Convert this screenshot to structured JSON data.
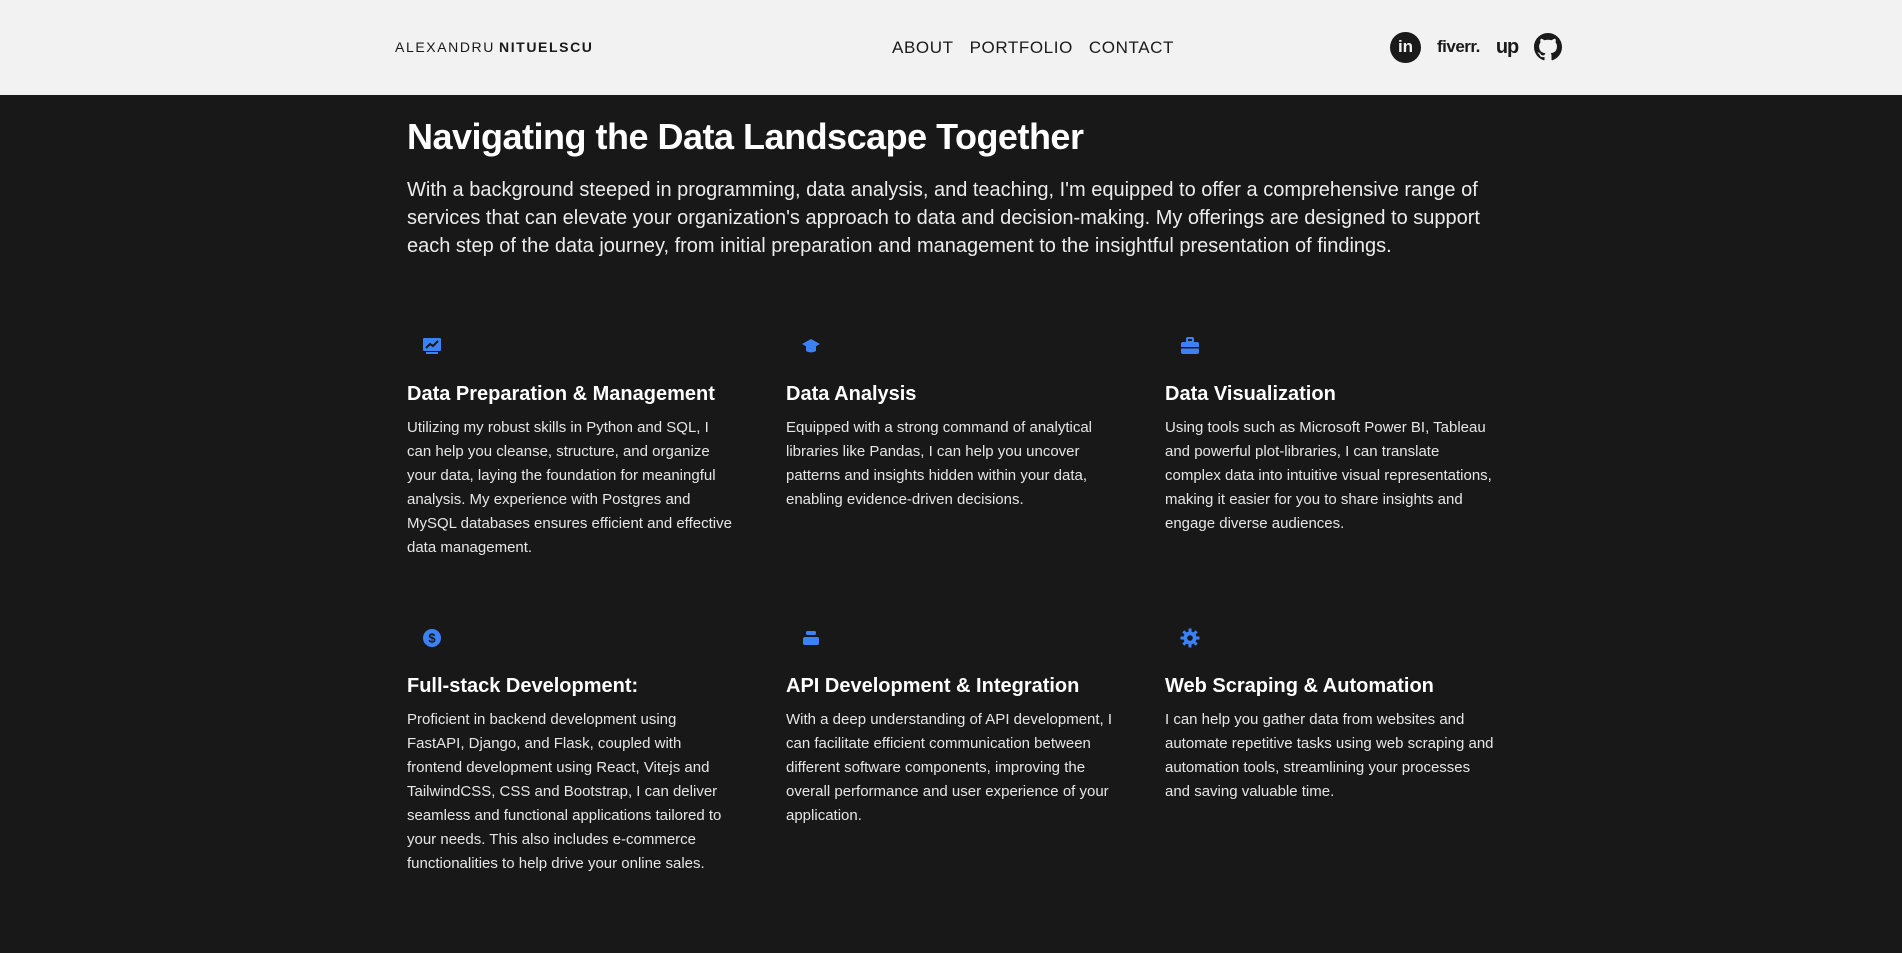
{
  "header": {
    "brand_first": "ALEXANDRU",
    "brand_last": "NITUELSCU",
    "nav": [
      {
        "label": "ABOUT"
      },
      {
        "label": "PORTFOLIO"
      },
      {
        "label": "CONTACT"
      }
    ],
    "socials": {
      "linkedin": "in",
      "fiverr": "fiverr.",
      "upwork": "up"
    }
  },
  "hero": {
    "title": "Navigating the Data Landscape Together",
    "description": "With a background steeped in programming, data analysis, and teaching, I'm equipped to offer a comprehensive range of services that can elevate your organization's approach to data and decision-making. My offerings are designed to support each step of the data journey, from initial preparation and management to the insightful presentation of findings."
  },
  "services": [
    {
      "icon": "chart-icon",
      "title": "Data Preparation & Management",
      "text": "Utilizing my robust skills in Python and SQL, I can help you cleanse, structure, and organize your data, laying the foundation for meaningful analysis. My experience with Postgres and MySQL databases ensures efficient and effective data management."
    },
    {
      "icon": "graduation-cap-icon",
      "title": "Data Analysis",
      "text": "Equipped with a strong command of analytical libraries like Pandas, I can help you uncover patterns and insights hidden within your data, enabling evidence-driven decisions."
    },
    {
      "icon": "briefcase-icon",
      "title": "Data Visualization",
      "text": "Using tools such as Microsoft Power BI, Tableau and powerful plot-libraries, I can translate complex data into intuitive visual representations, making it easier for you to share insights and engage diverse audiences."
    },
    {
      "icon": "dollar-circle-icon",
      "title": "Full-stack Development:",
      "text": "Proficient in backend development using FastAPI, Django, and Flask, coupled with frontend development using React, Vitejs and TailwindCSS, CSS and Bootstrap, I can deliver seamless and functional applications tailored to your needs. This also includes e-commerce functionalities to help drive your online sales."
    },
    {
      "icon": "stack-icon",
      "title": "API Development & Integration",
      "text": "With a deep understanding of API development, I can facilitate efficient communication between different software components, improving the overall performance and user experience of your application."
    },
    {
      "icon": "gear-icon",
      "title": "Web Scraping & Automation",
      "text": "I can help you gather data from websites and automate repetitive tasks using web scraping and automation tools, streamlining your processes and saving valuable time."
    }
  ],
  "colors": {
    "accent": "#3b82f6",
    "header_bg": "#f2f2f2",
    "page_bg": "#181818"
  }
}
